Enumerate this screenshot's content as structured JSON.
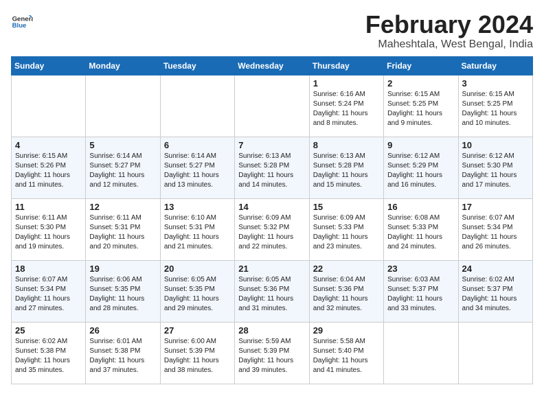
{
  "logo": {
    "line1": "General",
    "line2": "Blue"
  },
  "title": "February 2024",
  "subtitle": "Maheshtala, West Bengal, India",
  "header": {
    "days": [
      "Sunday",
      "Monday",
      "Tuesday",
      "Wednesday",
      "Thursday",
      "Friday",
      "Saturday"
    ]
  },
  "weeks": [
    [
      {
        "day": "",
        "info": ""
      },
      {
        "day": "",
        "info": ""
      },
      {
        "day": "",
        "info": ""
      },
      {
        "day": "",
        "info": ""
      },
      {
        "day": "1",
        "info": "Sunrise: 6:16 AM\nSunset: 5:24 PM\nDaylight: 11 hours\nand 8 minutes."
      },
      {
        "day": "2",
        "info": "Sunrise: 6:15 AM\nSunset: 5:25 PM\nDaylight: 11 hours\nand 9 minutes."
      },
      {
        "day": "3",
        "info": "Sunrise: 6:15 AM\nSunset: 5:25 PM\nDaylight: 11 hours\nand 10 minutes."
      }
    ],
    [
      {
        "day": "4",
        "info": "Sunrise: 6:15 AM\nSunset: 5:26 PM\nDaylight: 11 hours\nand 11 minutes."
      },
      {
        "day": "5",
        "info": "Sunrise: 6:14 AM\nSunset: 5:27 PM\nDaylight: 11 hours\nand 12 minutes."
      },
      {
        "day": "6",
        "info": "Sunrise: 6:14 AM\nSunset: 5:27 PM\nDaylight: 11 hours\nand 13 minutes."
      },
      {
        "day": "7",
        "info": "Sunrise: 6:13 AM\nSunset: 5:28 PM\nDaylight: 11 hours\nand 14 minutes."
      },
      {
        "day": "8",
        "info": "Sunrise: 6:13 AM\nSunset: 5:28 PM\nDaylight: 11 hours\nand 15 minutes."
      },
      {
        "day": "9",
        "info": "Sunrise: 6:12 AM\nSunset: 5:29 PM\nDaylight: 11 hours\nand 16 minutes."
      },
      {
        "day": "10",
        "info": "Sunrise: 6:12 AM\nSunset: 5:30 PM\nDaylight: 11 hours\nand 17 minutes."
      }
    ],
    [
      {
        "day": "11",
        "info": "Sunrise: 6:11 AM\nSunset: 5:30 PM\nDaylight: 11 hours\nand 19 minutes."
      },
      {
        "day": "12",
        "info": "Sunrise: 6:11 AM\nSunset: 5:31 PM\nDaylight: 11 hours\nand 20 minutes."
      },
      {
        "day": "13",
        "info": "Sunrise: 6:10 AM\nSunset: 5:31 PM\nDaylight: 11 hours\nand 21 minutes."
      },
      {
        "day": "14",
        "info": "Sunrise: 6:09 AM\nSunset: 5:32 PM\nDaylight: 11 hours\nand 22 minutes."
      },
      {
        "day": "15",
        "info": "Sunrise: 6:09 AM\nSunset: 5:33 PM\nDaylight: 11 hours\nand 23 minutes."
      },
      {
        "day": "16",
        "info": "Sunrise: 6:08 AM\nSunset: 5:33 PM\nDaylight: 11 hours\nand 24 minutes."
      },
      {
        "day": "17",
        "info": "Sunrise: 6:07 AM\nSunset: 5:34 PM\nDaylight: 11 hours\nand 26 minutes."
      }
    ],
    [
      {
        "day": "18",
        "info": "Sunrise: 6:07 AM\nSunset: 5:34 PM\nDaylight: 11 hours\nand 27 minutes."
      },
      {
        "day": "19",
        "info": "Sunrise: 6:06 AM\nSunset: 5:35 PM\nDaylight: 11 hours\nand 28 minutes."
      },
      {
        "day": "20",
        "info": "Sunrise: 6:05 AM\nSunset: 5:35 PM\nDaylight: 11 hours\nand 29 minutes."
      },
      {
        "day": "21",
        "info": "Sunrise: 6:05 AM\nSunset: 5:36 PM\nDaylight: 11 hours\nand 31 minutes."
      },
      {
        "day": "22",
        "info": "Sunrise: 6:04 AM\nSunset: 5:36 PM\nDaylight: 11 hours\nand 32 minutes."
      },
      {
        "day": "23",
        "info": "Sunrise: 6:03 AM\nSunset: 5:37 PM\nDaylight: 11 hours\nand 33 minutes."
      },
      {
        "day": "24",
        "info": "Sunrise: 6:02 AM\nSunset: 5:37 PM\nDaylight: 11 hours\nand 34 minutes."
      }
    ],
    [
      {
        "day": "25",
        "info": "Sunrise: 6:02 AM\nSunset: 5:38 PM\nDaylight: 11 hours\nand 35 minutes."
      },
      {
        "day": "26",
        "info": "Sunrise: 6:01 AM\nSunset: 5:38 PM\nDaylight: 11 hours\nand 37 minutes."
      },
      {
        "day": "27",
        "info": "Sunrise: 6:00 AM\nSunset: 5:39 PM\nDaylight: 11 hours\nand 38 minutes."
      },
      {
        "day": "28",
        "info": "Sunrise: 5:59 AM\nSunset: 5:39 PM\nDaylight: 11 hours\nand 39 minutes."
      },
      {
        "day": "29",
        "info": "Sunrise: 5:58 AM\nSunset: 5:40 PM\nDaylight: 11 hours\nand 41 minutes."
      },
      {
        "day": "",
        "info": ""
      },
      {
        "day": "",
        "info": ""
      }
    ]
  ]
}
